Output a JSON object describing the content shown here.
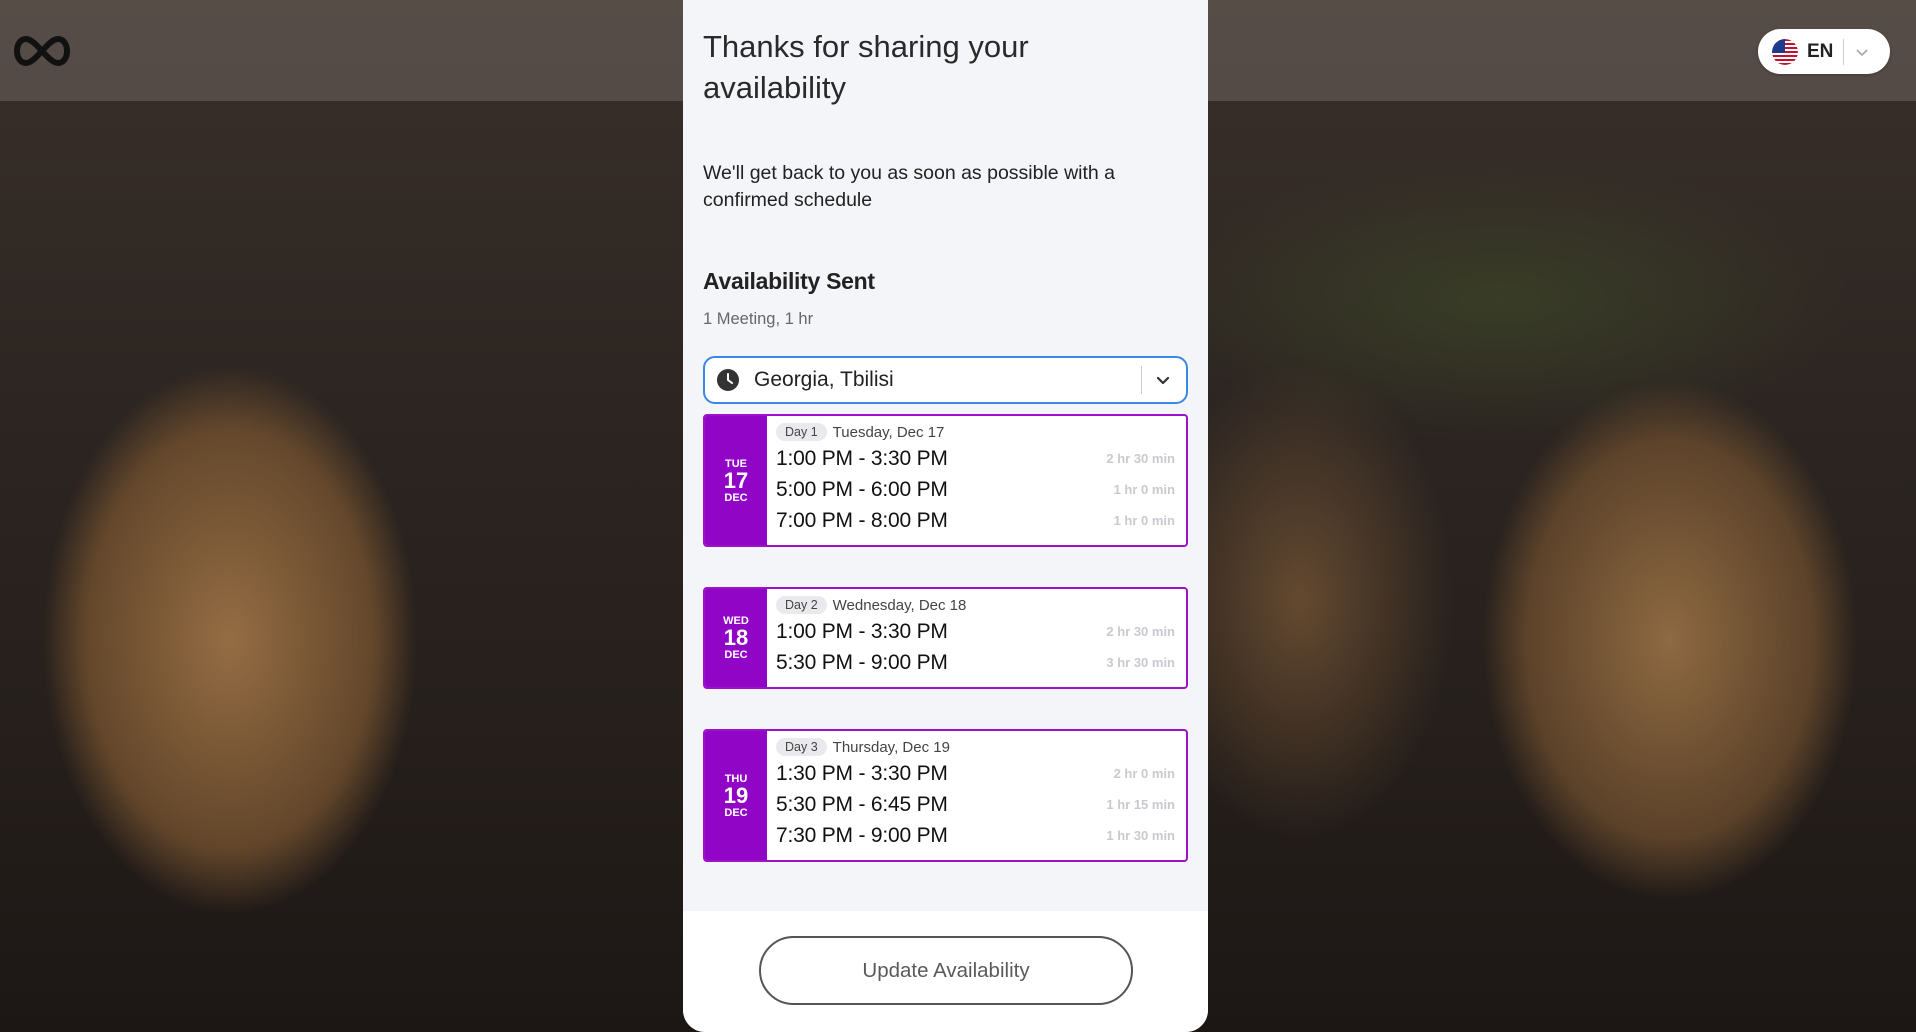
{
  "header": {
    "logo_icon": "infinity-logo-icon",
    "language": {
      "code": "EN",
      "flag_icon": "us-flag-icon"
    }
  },
  "panel": {
    "title": "Thanks for sharing your availability",
    "subtitle": "We'll get back to you as soon as possible with a confirmed schedule",
    "section_title": "Availability Sent",
    "meeting_info": "1 Meeting, 1 hr",
    "timezone": {
      "value": "Georgia, Tbilisi",
      "icon": "clock-icon"
    },
    "days": [
      {
        "dow": "TUE",
        "day": "17",
        "month": "DEC",
        "tag": "Day 1",
        "date": "Tuesday, Dec 17",
        "slots": [
          {
            "time": "1:00 PM - 3:30 PM",
            "duration": "2 hr 30 min"
          },
          {
            "time": "5:00 PM - 6:00 PM",
            "duration": "1 hr 0 min"
          },
          {
            "time": "7:00 PM - 8:00 PM",
            "duration": "1 hr 0 min"
          }
        ]
      },
      {
        "dow": "WED",
        "day": "18",
        "month": "DEC",
        "tag": "Day 2",
        "date": "Wednesday, Dec 18",
        "slots": [
          {
            "time": "1:00 PM - 3:30 PM",
            "duration": "2 hr 30 min"
          },
          {
            "time": "5:30 PM - 9:00 PM",
            "duration": "3 hr 30 min"
          }
        ]
      },
      {
        "dow": "THU",
        "day": "19",
        "month": "DEC",
        "tag": "Day 3",
        "date": "Thursday, Dec 19",
        "slots": [
          {
            "time": "1:30 PM - 3:30 PM",
            "duration": "2 hr 0 min"
          },
          {
            "time": "5:30 PM - 6:45 PM",
            "duration": "1 hr 15 min"
          },
          {
            "time": "7:30 PM - 9:00 PM",
            "duration": "1 hr 30 min"
          }
        ]
      }
    ],
    "update_button": "Update Availability"
  },
  "colors": {
    "accent_purple": "#9105c7",
    "focus_blue": "#3b86e6"
  }
}
